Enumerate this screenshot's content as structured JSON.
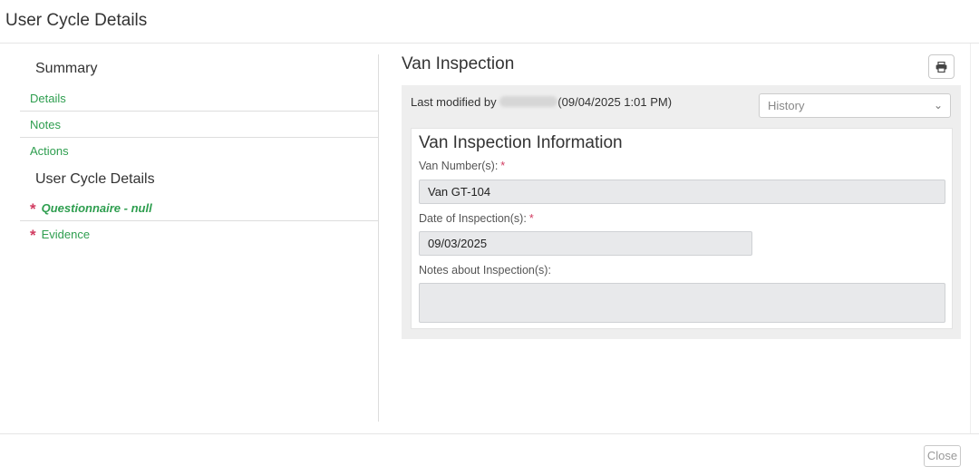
{
  "header": {
    "title": "User Cycle Details"
  },
  "sidebar": {
    "summary_heading": "Summary",
    "summary_items": [
      {
        "label": "Details"
      },
      {
        "label": "Notes"
      },
      {
        "label": "Actions"
      }
    ],
    "cycle_heading": "User Cycle Details",
    "cycle_items": [
      {
        "label": "Questionnaire - null",
        "required": true,
        "active": true
      },
      {
        "label": "Evidence",
        "required": true,
        "active": false
      }
    ]
  },
  "panel": {
    "title": "Van Inspection",
    "print_icon": "printer-icon",
    "last_modified_prefix": "Last modified by",
    "last_modified_suffix": "(09/04/2025 1:01 PM)",
    "history_placeholder": "History",
    "info": {
      "title": "Van Inspection Information",
      "van_number_label": "Van Number(s):",
      "van_number_value": "Van GT-104",
      "inspection_date_label": "Date of Inspection(s):",
      "inspection_date_value": "09/03/2025",
      "notes_label": "Notes about Inspection(s):",
      "notes_value": ""
    }
  },
  "footer": {
    "close_label": "Close"
  },
  "colors": {
    "accent_green": "#2e9e4f",
    "required_red": "#d13b60"
  }
}
